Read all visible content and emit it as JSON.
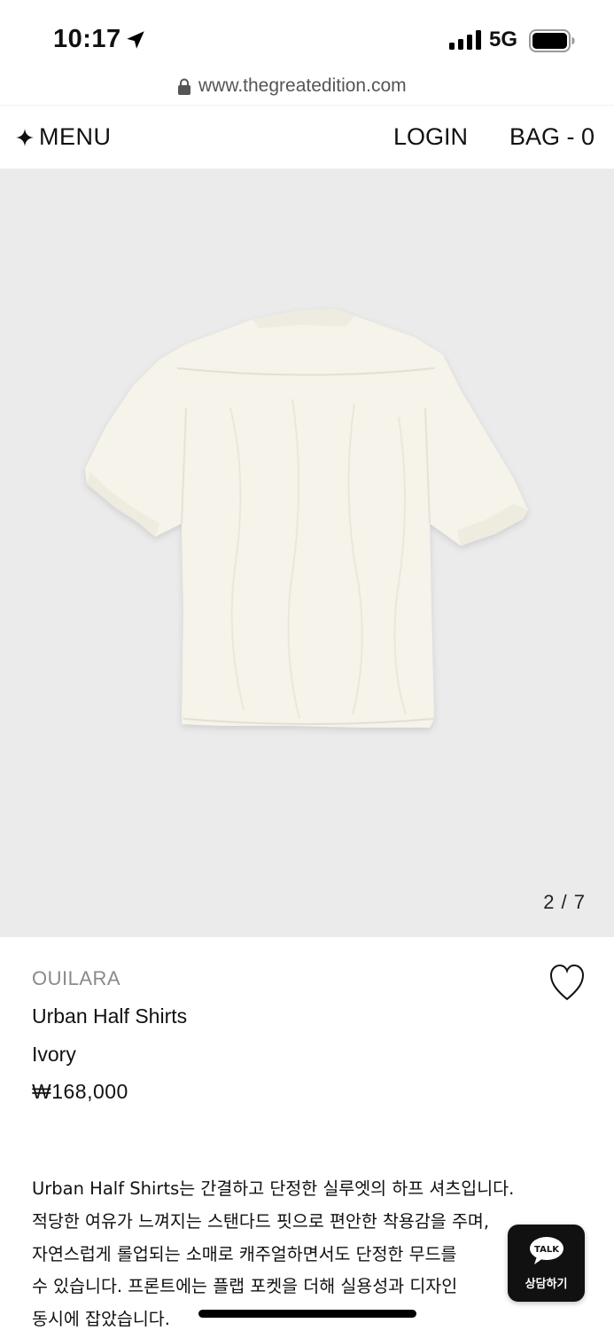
{
  "status_bar": {
    "time": "10:17",
    "network": "5G",
    "icons": [
      "location-arrow-icon",
      "signal-bars-icon",
      "battery-icon"
    ]
  },
  "browser": {
    "url": "www.thegreatedition.com",
    "icons": [
      "lock-icon"
    ]
  },
  "header": {
    "menu_label": "MENU",
    "login_label": "LOGIN",
    "bag_label": "BAG - 0",
    "icons": [
      "sparkle-icon"
    ]
  },
  "gallery": {
    "counter": "2 / 7",
    "image_description_icon": "shirt-image"
  },
  "product": {
    "brand": "OUILARA",
    "name": "Urban Half Shirts",
    "color": "Ivory",
    "price": "₩168,000",
    "icons": [
      "heart-icon"
    ]
  },
  "description": {
    "lines": [
      "Urban Half Shirts는 간결하고 단정한 실루엣의 하프 셔츠입니다.",
      "적당한 여유가 느껴지는 스탠다드 핏으로 편안한 착용감을 주며,",
      "자연스럽게 롤업되는 소매로 캐주얼하면서도 단정한 무드를",
      "수 있습니다. 프론트에는 플랩 포켓을 더해 실용성과 디자인",
      "동시에 잡았습니다."
    ]
  },
  "chat": {
    "bubble_text": "TALK",
    "label": "상담하기"
  },
  "colors": {
    "image_background": "#ebebeb",
    "shirt": "#f5f3ea",
    "brand_gray": "#8a8a8a",
    "chat_button": "#111111"
  }
}
